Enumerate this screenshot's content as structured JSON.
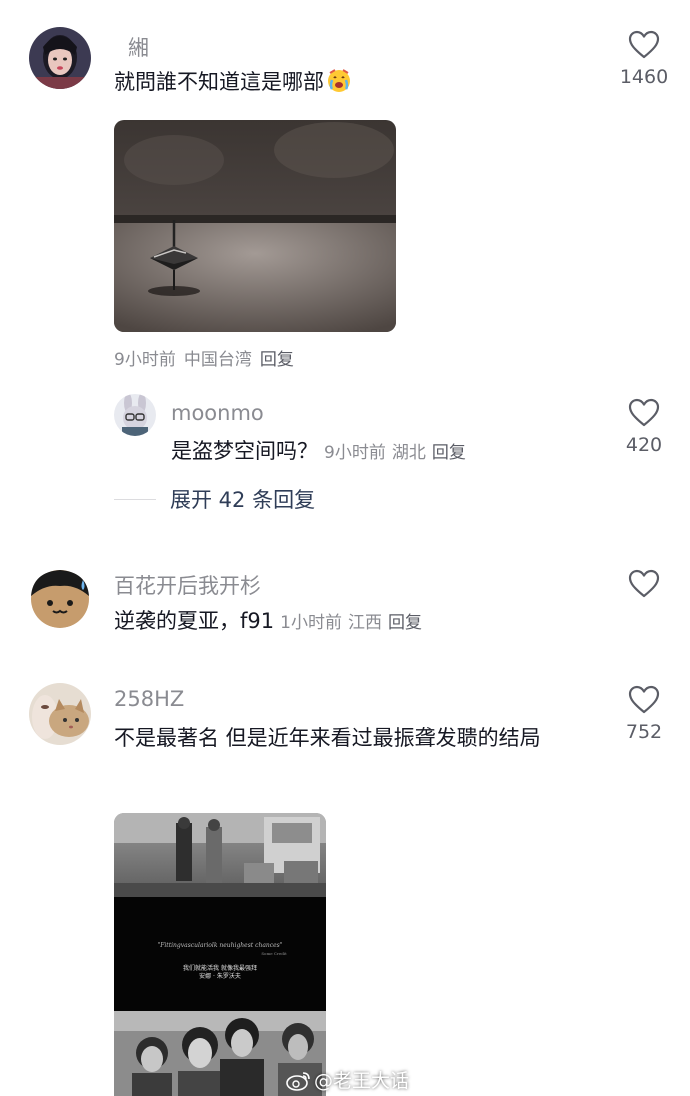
{
  "comments": [
    {
      "username": "緗",
      "text": "就問誰不知道這是哪部",
      "emoji": "crying-face-emoji",
      "time": "9小时前",
      "location": "中国台湾",
      "reply_label": "回复",
      "like_count": "1460",
      "image": "spinning-top-photo",
      "replies": [
        {
          "username": "moonmo",
          "text": "是盗梦空间吗？",
          "time": "9小时前",
          "location": "湖北",
          "reply_label": "回复",
          "like_count": "420"
        }
      ],
      "expand_label": "展开 42 条回复"
    },
    {
      "username": "百花开后我开杉",
      "text": "逆袭的夏亚，f91",
      "time": "1小时前",
      "location": "江西",
      "reply_label": "回复",
      "like_count": ""
    },
    {
      "username": "258HZ",
      "text": "不是最著名 但是近年来看过最振聋发聩的结局",
      "like_count": "752",
      "image": "film-still-collage"
    }
  ],
  "film_still": {
    "quote": "\"Fittingvasculariolk neuhighest chances\"",
    "quote_credit": "Some Credit",
    "caption_line1": "我们就能活我 就像我最强拜",
    "caption_line2": "安娜 · 朱罗沃夫"
  },
  "watermark": {
    "text": "@老王大话",
    "icon": "weibo-icon"
  },
  "colors": {
    "primary_text": "#161823",
    "secondary_text": "#8a8b91",
    "link_text": "#2f3d57"
  }
}
